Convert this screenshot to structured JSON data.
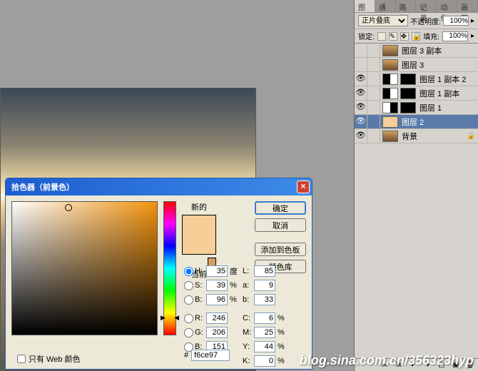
{
  "canvas": {
    "title": ""
  },
  "picker": {
    "title": "拾色器（前景色）",
    "new_label": "新的",
    "current_label": "当前",
    "buttons": {
      "ok": "确定",
      "cancel": "取消",
      "add": "添加到色板",
      "lib": "颜色库"
    },
    "hsb": {
      "h": "35",
      "s": "39",
      "b": "96",
      "h_unit": "度",
      "pct": "%"
    },
    "lab": {
      "l": "85",
      "a": "9",
      "b": "33"
    },
    "rgb": {
      "r": "246",
      "g": "206",
      "b": "151"
    },
    "cmyk": {
      "c": "6",
      "m": "25",
      "y": "44",
      "k": "0"
    },
    "hex": "f6ce97",
    "webonly": "只有 Web 颜色",
    "labels": {
      "H": "H:",
      "S": "S:",
      "B1": "B:",
      "R": "R:",
      "G": "G:",
      "B2": "B:",
      "L": "L:",
      "a": "a:",
      "b": "b:",
      "C": "C:",
      "M": "M:",
      "Y": "Y:",
      "K": "K:",
      "hash": "#"
    }
  },
  "layers": {
    "tabs": [
      "图层",
      "通道",
      "路径",
      "记录",
      "动作",
      "画笔"
    ],
    "opacity_label": "不透明度:",
    "opacity": "100%",
    "fill_label": "填充:",
    "fill": "100%",
    "blend": "正片叠底",
    "lock_label": "锁定:",
    "items": [
      {
        "name": "图层 3 副本",
        "visible": false,
        "thumb": "img"
      },
      {
        "name": "图层 3",
        "visible": false,
        "thumb": "img"
      },
      {
        "name": "图层 1 副本 2",
        "visible": true,
        "thumb": "bw",
        "mask": true
      },
      {
        "name": "图层 1 副本",
        "visible": true,
        "thumb": "bw",
        "mask": true
      },
      {
        "name": "图层 1",
        "visible": true,
        "thumb": "wb",
        "mask": true
      },
      {
        "name": "图层 2",
        "visible": true,
        "thumb": "solid",
        "selected": true
      },
      {
        "name": "背景",
        "visible": true,
        "thumb": "img",
        "locked": true
      }
    ]
  },
  "watermark": "blog.sina.com.cn/356323hyp"
}
